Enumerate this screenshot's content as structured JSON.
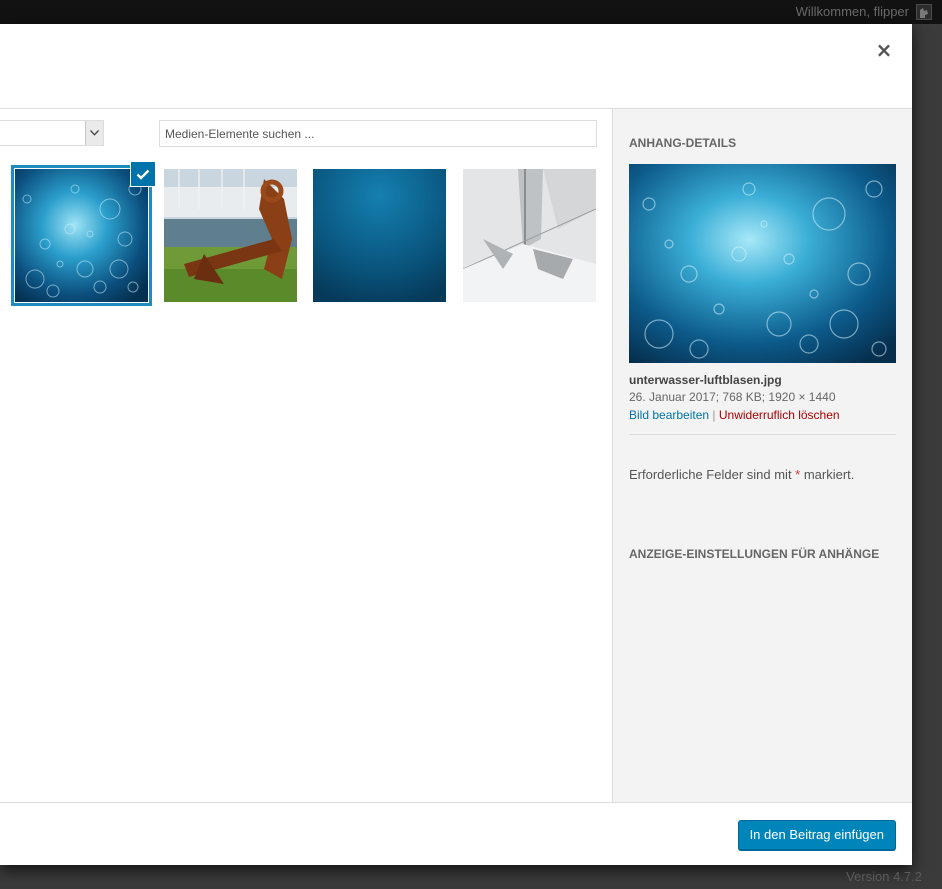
{
  "adminbar": {
    "welcome": "Willkommen, flipper"
  },
  "footer_version": "Version 4.7.2",
  "modal": {
    "close_symbol": "×",
    "search": {
      "placeholder": "Medien-Elemente suchen ...",
      "value": ""
    },
    "filter_select": {
      "value": ""
    },
    "grid": {
      "items": [
        {
          "name": "unterwasser-luftblasen",
          "selected": true
        },
        {
          "name": "anker",
          "selected": false
        },
        {
          "name": "meer-blau",
          "selected": false
        },
        {
          "name": "segelboot",
          "selected": false
        }
      ]
    },
    "sidebar": {
      "heading": "ANHANG-DETAILS",
      "filename": "unterwasser-luftblasen.jpg",
      "meta": "26. Januar 2017;  768 KB;  1920 × 1440",
      "edit_label": "Bild bearbeiten",
      "separator": " | ",
      "delete_label": "Unwiderruflich löschen",
      "required_prefix": "Erforderliche Felder sind mit ",
      "required_star": "*",
      "required_suffix": " markiert.",
      "display_settings_heading": "ANZEIGE-EINSTELLUNGEN FÜR ANHÄNGE"
    },
    "insert_button": "In den Beitrag einfügen"
  },
  "colors": {
    "primary_button": "#0085ba",
    "selection": "#1e8cbe",
    "delete_link": "#aa0000",
    "edit_link": "#0073aa"
  },
  "icons": {
    "close": "close-icon",
    "check": "checkmark-icon",
    "dropdown": "chevron-down-icon"
  }
}
